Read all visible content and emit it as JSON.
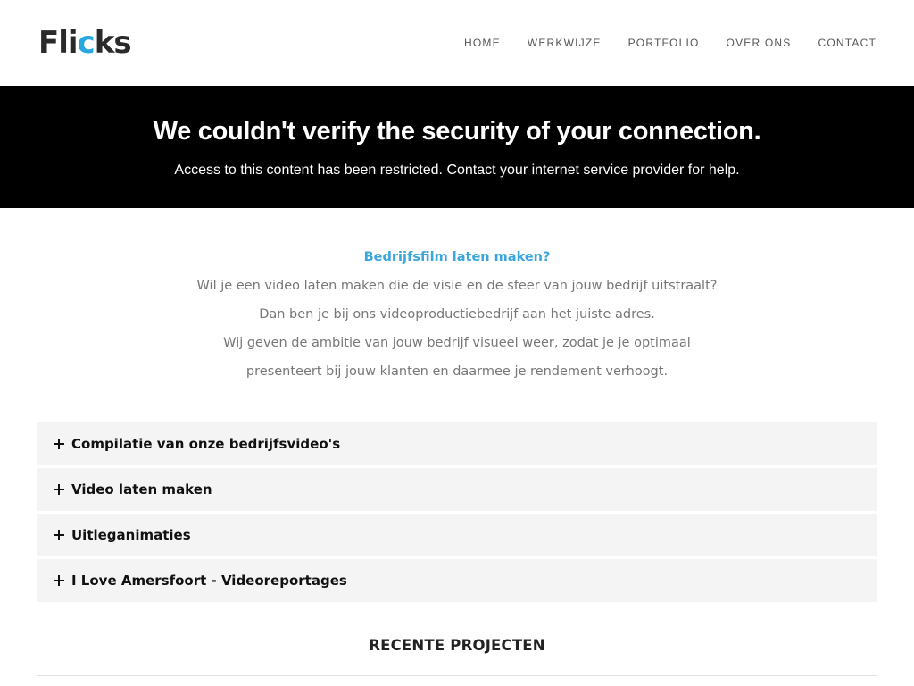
{
  "header": {
    "logo": {
      "part1": "Fli",
      "part2": "c",
      "part3": "ks"
    },
    "nav": [
      "HOME",
      "WERKWIJZE",
      "PORTFOLIO",
      "OVER ONS",
      "CONTACT"
    ]
  },
  "banner": {
    "title": "We couldn't verify the security of your connection.",
    "subtitle": "Access to this content has been restricted. Contact your internet service provider for help."
  },
  "intro": {
    "lead": "Bedrijfsfilm laten maken?",
    "lines": [
      "Wil je een video laten maken die de visie en de sfeer van jouw bedrijf uitstraalt?",
      "Dan ben je bij ons videoproductiebedrijf aan het juiste adres.",
      "Wij geven de ambitie van jouw bedrijf visueel weer, zodat je je optimaal",
      "presenteert bij jouw klanten en daarmee je rendement verhoogt."
    ]
  },
  "accordion": [
    {
      "label": "Compilatie van onze bedrijfsvideo's",
      "icon": "plus-icon"
    },
    {
      "label": "Video laten maken",
      "icon": "plus-icon"
    },
    {
      "label": "Uitleganimaties",
      "icon": "plus-icon"
    },
    {
      "label": "I Love Amersfoort - Videoreportages",
      "icon": "plus-icon"
    }
  ],
  "recent": {
    "title": "RECENTE PROJECTEN"
  },
  "colors": {
    "accent": "#29a8e0",
    "banner_bg": "#000000",
    "accordion_bg": "#f4f4f4"
  }
}
